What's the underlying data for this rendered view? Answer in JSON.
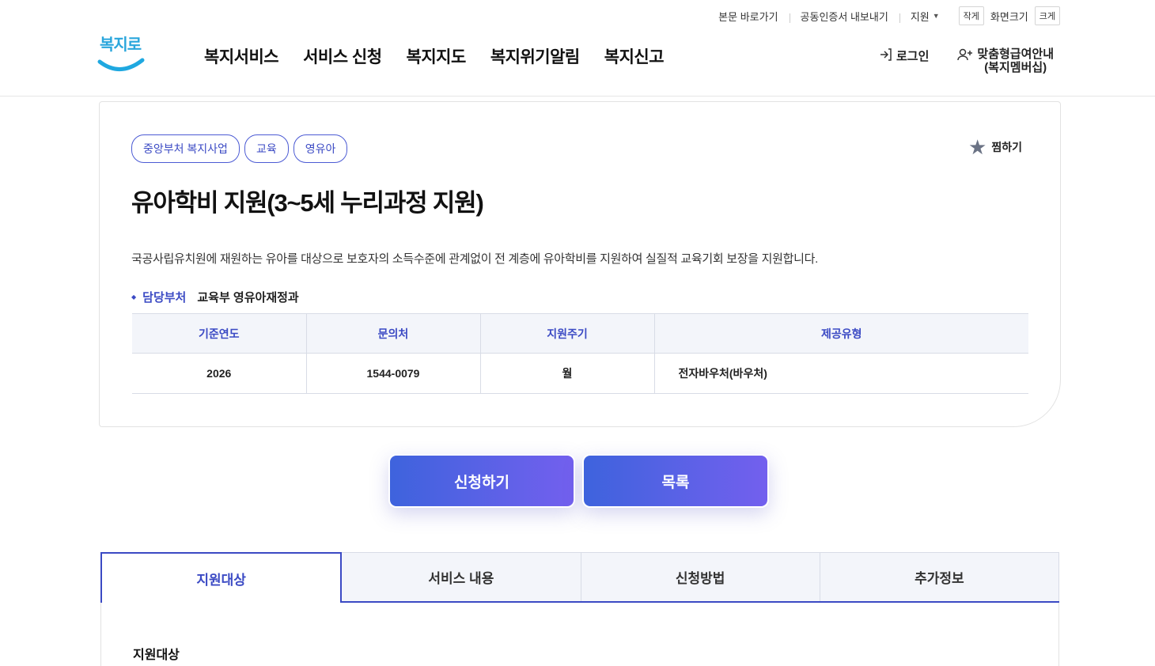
{
  "utility": {
    "skip_link": "본문 바로가기",
    "cert_export": "공동인증서 내보내기",
    "language": "지원",
    "font_small": "작게",
    "font_size_label": "화면크기",
    "font_large": "크게"
  },
  "logo": {
    "text": "복지로"
  },
  "gnb": [
    "복지서비스",
    "서비스 신청",
    "복지지도",
    "복지위기알림",
    "복지신고"
  ],
  "header_right": {
    "login": "로그인",
    "member_line1": "맞춤형급여안내",
    "member_line2": "(복지멤버십)"
  },
  "service": {
    "tags": [
      "중앙부처 복지사업",
      "교육",
      "영유아"
    ],
    "bookmark": "찜하기",
    "title": "유아학비 지원(3~5세 누리과정 지원)",
    "description": "국공사립유치원에 재원하는 유아를 대상으로 보호자의 소득수준에 관계없이 전 계층에 유아학비를 지원하여 실질적 교육기회 보장을 지원합니다.",
    "dept_label": "담당부처",
    "dept_value": "교육부 영유아재정과",
    "table": {
      "headers": [
        "기준연도",
        "문의처",
        "지원주기",
        "제공유형"
      ],
      "row": [
        "2026",
        "1544-0079",
        "월",
        "전자바우처(바우처)"
      ]
    }
  },
  "buttons": {
    "apply": "신청하기",
    "list": "목록"
  },
  "tabs": [
    "지원대상",
    "서비스 내용",
    "신청방법",
    "추가정보"
  ],
  "panel": {
    "heading": "지원대상"
  }
}
